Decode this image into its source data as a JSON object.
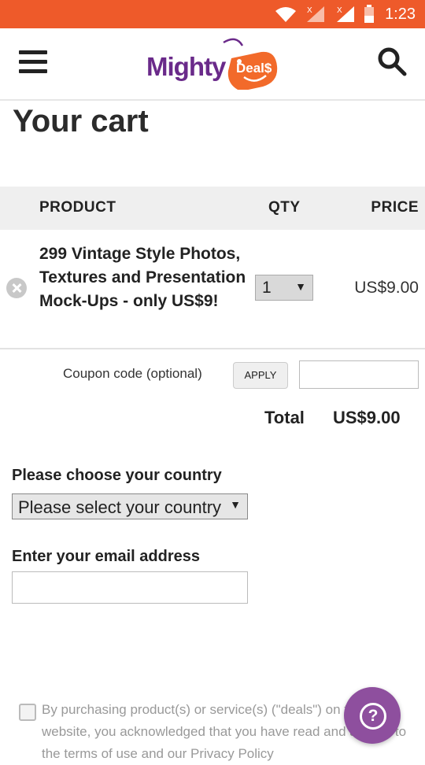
{
  "status_bar": {
    "time": "1:23"
  },
  "header": {
    "logo_mighty": "Mighty",
    "logo_deals": "Deal$"
  },
  "page": {
    "title": "Your cart"
  },
  "cart": {
    "columns": {
      "product": "PRODUCT",
      "qty": "QTY",
      "price": "PRICE"
    },
    "items": [
      {
        "name": "299 Vintage Style Photos, Textures and Presentation Mock-Ups - only US$9!",
        "qty": "1",
        "price": "US$9.00"
      }
    ],
    "coupon": {
      "label": "Coupon code (optional)",
      "apply_label": "APPLY",
      "value": ""
    },
    "total_label": "Total",
    "total_value": "US$9.00"
  },
  "checkout": {
    "country_label": "Please choose your country",
    "country_selected": "Please select your country",
    "email_label": "Enter your email address",
    "email_value": "",
    "agreement_text": "By purchasing product(s) or service(s) (\"deals\") on this website, you acknowledged that you have read and agreed to the terms of use and our Privacy Policy"
  },
  "help": {
    "label": "?"
  },
  "colors": {
    "status_bar": "#ee5a2a",
    "brand_purple": "#6a2a8a",
    "brand_orange": "#f26a2a",
    "help_button": "#8e4f9e"
  }
}
